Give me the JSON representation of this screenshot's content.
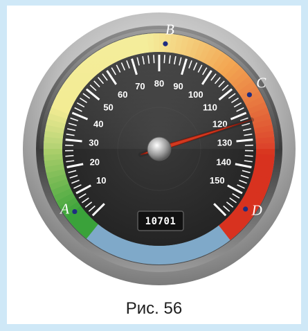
{
  "gauge": {
    "min": 0,
    "max": 160,
    "major_step": 10,
    "minor_step": 2,
    "number_labels": [
      "10",
      "20",
      "30",
      "40",
      "50",
      "60",
      "70",
      "80",
      "90",
      "100",
      "110",
      "120",
      "130",
      "140",
      "150"
    ],
    "needle_value": 123,
    "odometer": "10701"
  },
  "points": [
    {
      "label": "A",
      "value": 5
    },
    {
      "label": "B",
      "value": 82
    },
    {
      "label": "C",
      "value": 115
    },
    {
      "label": "D",
      "value": 154
    }
  ],
  "colors": {
    "frame_bg": "#cfe8f7",
    "dial_face": "#2c2c2c",
    "needle": "#d3391f",
    "point_dot": "#1f2d80",
    "arc_green": "#3aa23a",
    "arc_yellow": "#f2ea8a",
    "arc_orange": "#f19a3a",
    "arc_red": "#d8321f"
  },
  "caption": "Рис. 56"
}
